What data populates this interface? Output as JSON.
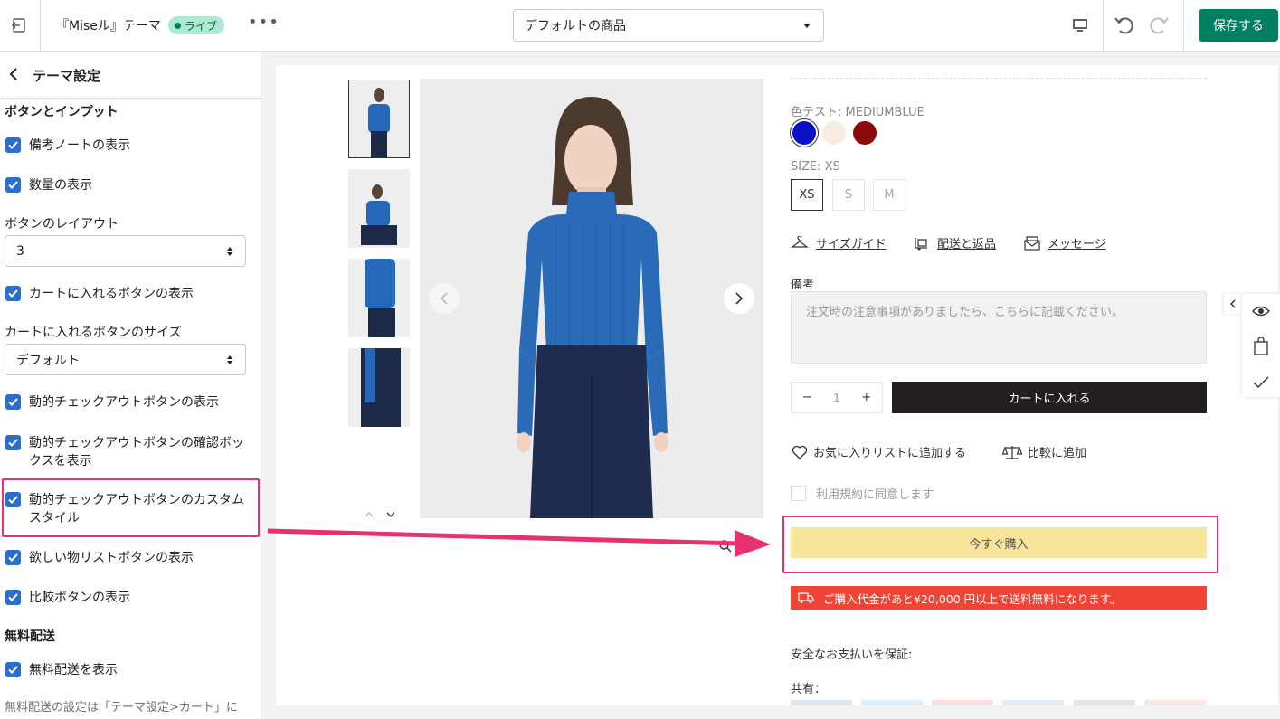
{
  "topbar": {
    "title": "『Miseル』テーマ",
    "live_badge": "ライブ",
    "more": "•••",
    "template_select": "デフォルトの商品",
    "save_label": "保存する"
  },
  "sidebar": {
    "header": "テーマ設定",
    "section_buttons": "ボタンとインプット",
    "cb_notes": "備考ノートの表示",
    "cb_qty": "数量の表示",
    "layout_label": "ボタンのレイアウト",
    "layout_value": "3",
    "cb_add_cart": "カートに入れるボタンの表示",
    "size_label": "カートに入れるボタンのサイズ",
    "size_value": "デフォルト",
    "cb_dynamic": "動的チェックアウトボタンの表示",
    "cb_dynamic_confirm": "動的チェックアウトボタンの確認ボックスを表示",
    "cb_dynamic_custom": "動的チェックアウトボタンのカスタムスタイル",
    "cb_wishlist": "欲しい物リストボタンの表示",
    "cb_compare": "比較ボタンの表示",
    "section_shipping": "無料配送",
    "cb_free_shipping": "無料配送を表示",
    "note": "無料配送の設定は「テーマ設定>カート」に"
  },
  "product": {
    "color_label": "色テスト: MEDIUMBLUE",
    "colors": [
      "#0a10c8",
      "#f7ece1",
      "#8b0a0a"
    ],
    "size_label": "SIZE: XS",
    "sizes": [
      "XS",
      "S",
      "M"
    ],
    "size_guide": "サイズガイド",
    "shipping_returns": "配送と返品",
    "message": "メッセージ",
    "note_label": "備考",
    "note_placeholder": "注文時の注意事項がありましたら、こちらに記載ください。",
    "qty_minus": "−",
    "qty_value": "1",
    "qty_plus": "+",
    "add_to_cart": "カートに入れる",
    "add_wishlist": "お気に入りリストに追加する",
    "add_compare": "比較に追加",
    "terms": "利用規約に同意します",
    "buy_now": "今すぐ購入",
    "free_shipping_msg": "ご購入代金があと¥20,000 円以上で送料無料になります。",
    "secure_payment": "安全なお支払いを保証:",
    "share": "共有："
  },
  "colors": {
    "accent": "#008060",
    "highlight": "#e8326f",
    "checkbox": "#2c6ecb",
    "buy_now_bg": "#f7e59c",
    "banner_bg": "#f04435"
  }
}
